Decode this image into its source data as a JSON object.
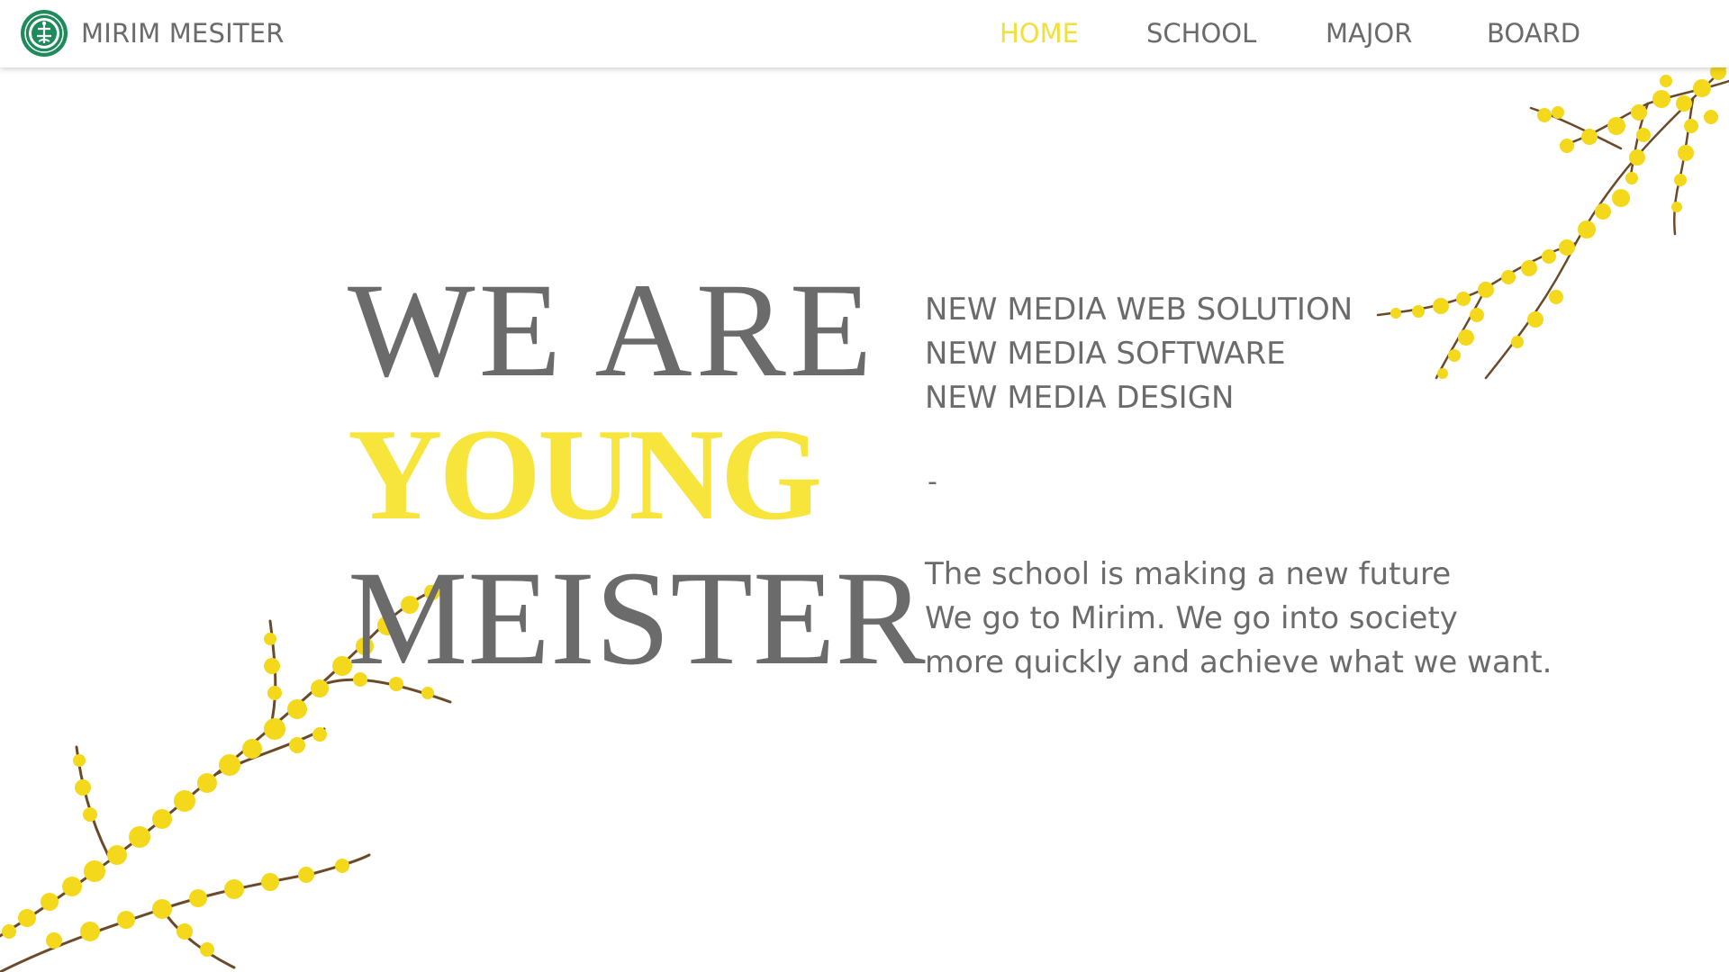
{
  "header": {
    "brand_name": "MIRIM MESITER",
    "nav": [
      {
        "label": "HOME",
        "active": true
      },
      {
        "label": "SCHOOL",
        "active": false
      },
      {
        "label": "MAJOR",
        "active": false
      },
      {
        "label": "BOARD",
        "active": false
      }
    ]
  },
  "hero": {
    "line1": "WE ARE",
    "line2": "YOUNG",
    "line3": "MEISTER",
    "majors": [
      "NEW MEDIA WEB SOLUTION",
      "NEW MEDIA SOFTWARE",
      "NEW MEDIA DESIGN"
    ],
    "separator": "-",
    "description": [
      "The school is making a new future",
      "We go to Mirim. We go into society",
      "more quickly and achieve what we want."
    ]
  },
  "icons": {
    "logo": "school-emblem-icon",
    "decoration": "forsythia-branch-icon"
  },
  "colors": {
    "accent_yellow": "#f7e53c",
    "nav_active": "#f2df3a",
    "text_gray": "#6b6b6b",
    "emblem_green": "#1f8a5b",
    "flower_yellow": "#f4d81c",
    "stem_brown": "#6b4a2a"
  }
}
